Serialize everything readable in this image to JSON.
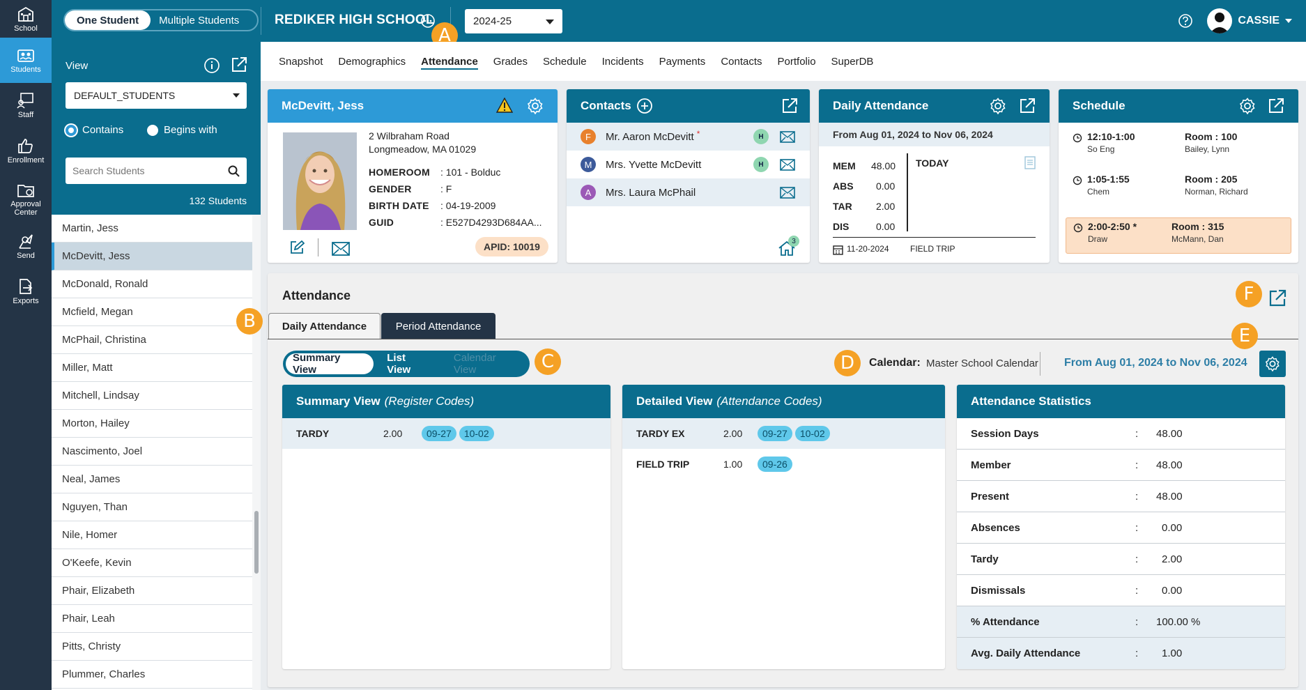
{
  "rail": [
    {
      "label": "School",
      "icon": "school-icon"
    },
    {
      "label": "Students",
      "icon": "students-icon"
    },
    {
      "label": "Staff",
      "icon": "staff-icon"
    },
    {
      "label": "Enrollment",
      "icon": "thumbs-up-icon"
    },
    {
      "label": "Approval Center",
      "icon": "approval-icon"
    },
    {
      "label": "Send",
      "icon": "send-icon"
    },
    {
      "label": "Exports",
      "icon": "export-icon"
    }
  ],
  "topbar": {
    "one_student": "One Student",
    "multiple_students": "Multiple Students",
    "school_name": "REDIKER HIGH SCHOOL",
    "year": "2024-25",
    "user": "CASSIE"
  },
  "leftpanel": {
    "view_label": "View",
    "view_value": "DEFAULT_STUDENTS",
    "contains": "Contains",
    "begins_with": "Begins with",
    "search_placeholder": "Search Students",
    "count": "132 Students"
  },
  "students": [
    "Martin, Jess",
    "McDevitt, Jess",
    "McDonald, Ronald",
    "Mcfield, Megan",
    "McPhail, Christina",
    "Miller, Matt",
    "Mitchell, Lindsay",
    "Morton, Hailey",
    "Nascimento, Joel",
    "Neal, James",
    "Nguyen, Than",
    "Nile, Homer",
    "O'Keefe, Kevin",
    "Phair, Elizabeth",
    "Phair, Leah",
    "Pitts, Christy",
    "Plummer, Charles"
  ],
  "tabs": [
    "Snapshot",
    "Demographics",
    "Attendance",
    "Grades",
    "Schedule",
    "Incidents",
    "Payments",
    "Contacts",
    "Portfolio",
    "SuperDB"
  ],
  "student": {
    "name": "McDevitt, Jess",
    "address1": "2 Wilbraham Road",
    "address2": "Longmeadow, MA 01029",
    "homeroom_label": "HOMEROOM",
    "homeroom": ": 101 - Bolduc",
    "gender_label": "GENDER",
    "gender": ": F",
    "birth_label": "BIRTH DATE",
    "birth": ": 04-19-2009",
    "guid_label": "GUID",
    "guid": ": E527D4293D684AA...",
    "apid": "APID:  10019"
  },
  "contacts": {
    "title": "Contacts",
    "items": [
      {
        "initial": "F",
        "name": "Mr. Aaron McDevitt",
        "flag": "H",
        "color": "#e8812d"
      },
      {
        "initial": "M",
        "name": "Mrs. Yvette McDevitt",
        "flag": "H",
        "color": "#3c5a9a"
      },
      {
        "initial": "A",
        "name": "Mrs. Laura McPhail",
        "flag": "",
        "color": "#9b59b6"
      }
    ],
    "home_badge": "3"
  },
  "daily": {
    "title": "Daily Attendance",
    "range": "From Aug 01, 2024 to Nov 06, 2024",
    "rows": [
      {
        "k": "MEM",
        "v": "48.00"
      },
      {
        "k": "ABS",
        "v": "0.00"
      },
      {
        "k": "TAR",
        "v": "2.00"
      },
      {
        "k": "DIS",
        "v": "0.00"
      }
    ],
    "today": "TODAY",
    "date": "11-20-2024",
    "event": "FIELD TRIP"
  },
  "schedule": {
    "title": "Schedule",
    "items": [
      {
        "time": "12:10-1:00",
        "course": "So Eng",
        "room": "Room : 100",
        "teacher": "Bailey, Lynn"
      },
      {
        "time": "1:05-1:55",
        "course": "Chem",
        "room": "Room : 205",
        "teacher": "Norman, Richard"
      },
      {
        "time": "2:00-2:50 *",
        "course": "Draw",
        "room": "Room : 315",
        "teacher": "McMann, Dan"
      }
    ]
  },
  "attendance": {
    "title": "Attendance",
    "tab_daily": "Daily Attendance",
    "tab_period": "Period Attendance",
    "view_summary": "Summary View",
    "view_list": "List View",
    "view_calendar": "Calendar View",
    "calendar_label": "Calendar:",
    "calendar_value": "Master School Calendar",
    "range": "From Aug 01, 2024 to Nov 06, 2024",
    "summary_title": "Summary View",
    "summary_sub": "(Register Codes)",
    "summary_rows": [
      {
        "code": "TARDY",
        "value": "2.00",
        "dates": [
          "09-27",
          "10-02"
        ]
      }
    ],
    "detail_title": "Detailed View",
    "detail_sub": "(Attendance Codes)",
    "detail_rows": [
      {
        "code": "TARDY EX",
        "value": "2.00",
        "dates": [
          "09-27",
          "10-02"
        ]
      },
      {
        "code": "FIELD TRIP",
        "value": "1.00",
        "dates": [
          "09-26"
        ]
      }
    ],
    "stats_title": "Attendance Statistics",
    "stats": [
      {
        "label": "Session Days",
        "value": "48.00"
      },
      {
        "label": "Member",
        "value": "48.00"
      },
      {
        "label": "Present",
        "value": "48.00"
      },
      {
        "label": "Absences",
        "value": "0.00"
      },
      {
        "label": "Tardy",
        "value": "2.00"
      },
      {
        "label": "Dismissals",
        "value": "0.00"
      },
      {
        "label": "% Attendance",
        "value": "100.00 %"
      },
      {
        "label": "Avg. Daily Attendance",
        "value": "1.00"
      }
    ]
  },
  "markers": [
    "A",
    "B",
    "C",
    "D",
    "E",
    "F"
  ],
  "colors": {
    "primary": "#0a6d8e",
    "accent": "#2d9ad7",
    "marker": "#f5a125",
    "rail": "#243446"
  }
}
